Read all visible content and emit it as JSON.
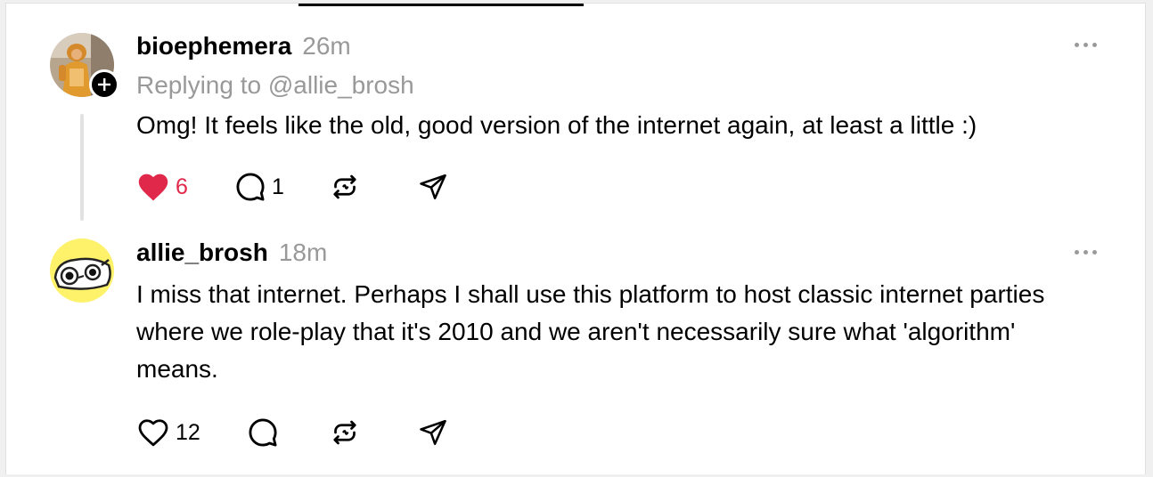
{
  "posts": [
    {
      "username": "bioephemera",
      "time": "26m",
      "reply_to": "Replying to @allie_brosh",
      "text": "Omg! It feels like the old, good version of the internet again, at least a little :)",
      "likes": "6",
      "liked": true,
      "replies": "1",
      "avatar_icon": "person-in-costume-avatar"
    },
    {
      "username": "allie_brosh",
      "time": "18m",
      "text": "I miss that internet. Perhaps I shall use this platform to host classic internet parties where we role-play that it's 2010 and we aren't necessarily sure what 'algorithm' means.",
      "likes": "12",
      "liked": false,
      "replies": "",
      "avatar_icon": "cartoon-face-avatar"
    }
  ],
  "colors": {
    "like_active": "#e0294a",
    "secondary_text": "#999999",
    "avatar_yellow": "#fff26b"
  }
}
